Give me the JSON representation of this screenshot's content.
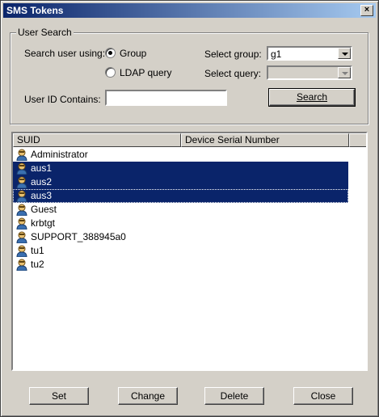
{
  "window": {
    "title": "SMS Tokens",
    "close_label": "×"
  },
  "user_search": {
    "legend": "User Search",
    "search_using_label": "Search user using:",
    "radio_group": "Group",
    "radio_ldap": "LDAP query",
    "selected_radio": "Group",
    "select_group_label": "Select group:",
    "select_group_value": "g1",
    "select_query_label": "Select query:",
    "select_query_value": "",
    "userid_label": "User ID Contains:",
    "userid_value": "",
    "search_button": "Search"
  },
  "list": {
    "columns": [
      "SUID",
      "Device Serial Number"
    ],
    "rows": [
      {
        "suid": "Administrator",
        "serial": "",
        "selected": false
      },
      {
        "suid": "aus1",
        "serial": "",
        "selected": true
      },
      {
        "suid": "aus2",
        "serial": "",
        "selected": true
      },
      {
        "suid": "aus3",
        "serial": "",
        "selected": true
      },
      {
        "suid": "Guest",
        "serial": "",
        "selected": false
      },
      {
        "suid": "krbtgt",
        "serial": "",
        "selected": false
      },
      {
        "suid": "SUPPORT_388945a0",
        "serial": "",
        "selected": false
      },
      {
        "suid": "tu1",
        "serial": "",
        "selected": false
      },
      {
        "suid": "tu2",
        "serial": "",
        "selected": false
      }
    ]
  },
  "buttons": {
    "set": "Set",
    "change": "Change",
    "delete": "Delete",
    "close": "Close"
  },
  "colors": {
    "selection": "#0a246a",
    "face": "#d4d0c8",
    "title_start": "#0a246a",
    "title_end": "#a6caf0"
  },
  "icons": {
    "user": "user-icon"
  }
}
